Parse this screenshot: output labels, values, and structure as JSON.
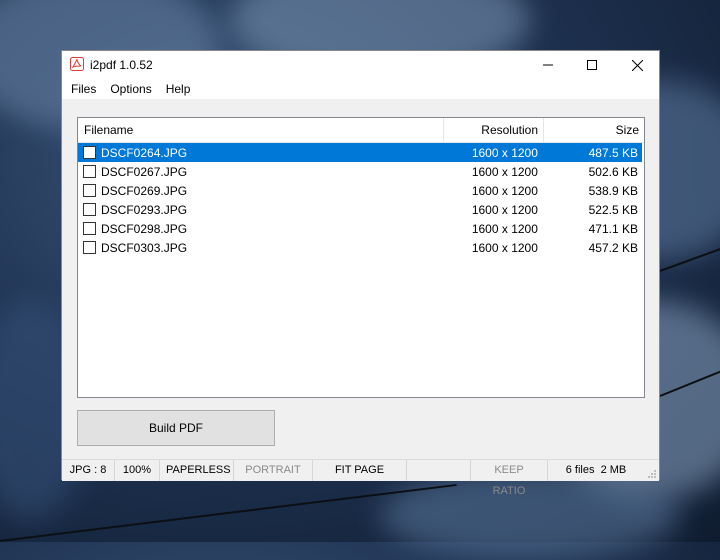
{
  "window": {
    "title": "i2pdf 1.0.52",
    "minimize_icon": "minimize-icon",
    "maximize_icon": "maximize-icon",
    "close_icon": "close-icon"
  },
  "menu": [
    "Files",
    "Options",
    "Help"
  ],
  "list": {
    "columns": [
      "Filename",
      "Resolution",
      "Size"
    ],
    "rows": [
      {
        "filename": "DSCF0264.JPG",
        "resolution": "1600 x 1200",
        "size": "487.5 KB",
        "selected": true
      },
      {
        "filename": "DSCF0267.JPG",
        "resolution": "1600 x 1200",
        "size": "502.6 KB",
        "selected": false
      },
      {
        "filename": "DSCF0269.JPG",
        "resolution": "1600 x 1200",
        "size": "538.9 KB",
        "selected": false
      },
      {
        "filename": "DSCF0293.JPG",
        "resolution": "1600 x 1200",
        "size": "522.5 KB",
        "selected": false
      },
      {
        "filename": "DSCF0298.JPG",
        "resolution": "1600 x 1200",
        "size": "471.1 KB",
        "selected": false
      },
      {
        "filename": "DSCF0303.JPG",
        "resolution": "1600 x 1200",
        "size": "457.2 KB",
        "selected": false
      }
    ]
  },
  "build_button": "Build PDF",
  "status": {
    "quality": "JPG : 8",
    "zoom": "100%",
    "paper": "PAPERLESS",
    "orientation": "PORTRAIT",
    "fit": "FIT PAGE",
    "ratio": "KEEP RATIO",
    "summary": "6 files  2 MB"
  },
  "colors": {
    "selection": "#0078d7",
    "accent": "#e53935"
  }
}
